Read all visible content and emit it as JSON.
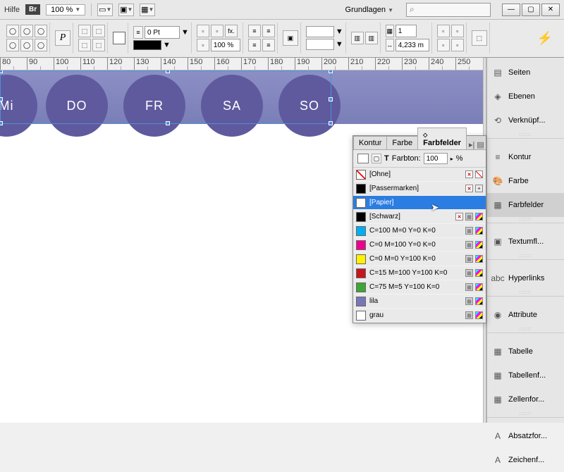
{
  "topbar": {
    "help": "Hilfe",
    "br": "Br",
    "zoom": "100 %",
    "workspace": "Grundlagen",
    "search_placeholder": ""
  },
  "options": {
    "stroke_weight": "0 Pt",
    "opacity": "100 %",
    "field_val": "1",
    "field_val2": "4,233 m"
  },
  "ruler_ticks": [
    80,
    90,
    100,
    110,
    120,
    130,
    140,
    150,
    160,
    170,
    180,
    190,
    200,
    210,
    220,
    230,
    240,
    250
  ],
  "days": [
    "Mi",
    "DO",
    "FR",
    "SA",
    "SO"
  ],
  "day_positions": [
    -35,
    65,
    175,
    285,
    395
  ],
  "swatches_panel": {
    "tabs": [
      "Kontur",
      "Farbe",
      "Farbfelder"
    ],
    "active_tab": 2,
    "tint_label": "Farbton:",
    "tint_value": "100",
    "tint_unit": "%",
    "t_icon": "T"
  },
  "swatches": [
    {
      "name": "[Ohne]",
      "color": "none",
      "lock": true,
      "none": true
    },
    {
      "name": "[Passermarken]",
      "color": "#000",
      "reg": true,
      "lock": true
    },
    {
      "name": "[Papier]",
      "color": "#fff",
      "selected": true
    },
    {
      "name": "[Schwarz]",
      "color": "#000",
      "lock": true,
      "cmyk": true
    },
    {
      "name": "C=100 M=0 Y=0 K=0",
      "color": "#00aeef",
      "cmyk": true
    },
    {
      "name": "C=0 M=100 Y=0 K=0",
      "color": "#ec008c",
      "cmyk": true
    },
    {
      "name": "C=0 M=0 Y=100 K=0",
      "color": "#fff200",
      "cmyk": true
    },
    {
      "name": "C=15 M=100 Y=100 K=0",
      "color": "#c4161c",
      "cmyk": true
    },
    {
      "name": "C=75 M=5 Y=100 K=0",
      "color": "#3fa535",
      "cmyk": true
    },
    {
      "name": "lila",
      "color": "#7976b8",
      "cmyk": true
    },
    {
      "name": "grau",
      "color": "#fff",
      "cmyk": true
    }
  ],
  "dock": [
    {
      "label": "Seiten",
      "icon": "▤"
    },
    {
      "label": "Ebenen",
      "icon": "◈"
    },
    {
      "label": "Verknüpf...",
      "icon": "⟲"
    },
    {
      "sep": true
    },
    {
      "label": "Kontur",
      "icon": "≡"
    },
    {
      "label": "Farbe",
      "icon": "🎨"
    },
    {
      "label": "Farbfelder",
      "icon": "▦",
      "active": true
    },
    {
      "sep": true
    },
    {
      "label": "Textumfl...",
      "icon": "▣"
    },
    {
      "sep": true
    },
    {
      "label": "Hyperlinks",
      "icon": "abc"
    },
    {
      "sep": true
    },
    {
      "label": "Attribute",
      "icon": "◉"
    },
    {
      "sep": true
    },
    {
      "label": "Tabelle",
      "icon": "▦"
    },
    {
      "label": "Tabellenf...",
      "icon": "▦"
    },
    {
      "label": "Zellenfor...",
      "icon": "▦"
    },
    {
      "sep": true
    },
    {
      "label": "Absatzfor...",
      "icon": "A"
    },
    {
      "label": "Zeichenf...",
      "icon": "A"
    }
  ]
}
